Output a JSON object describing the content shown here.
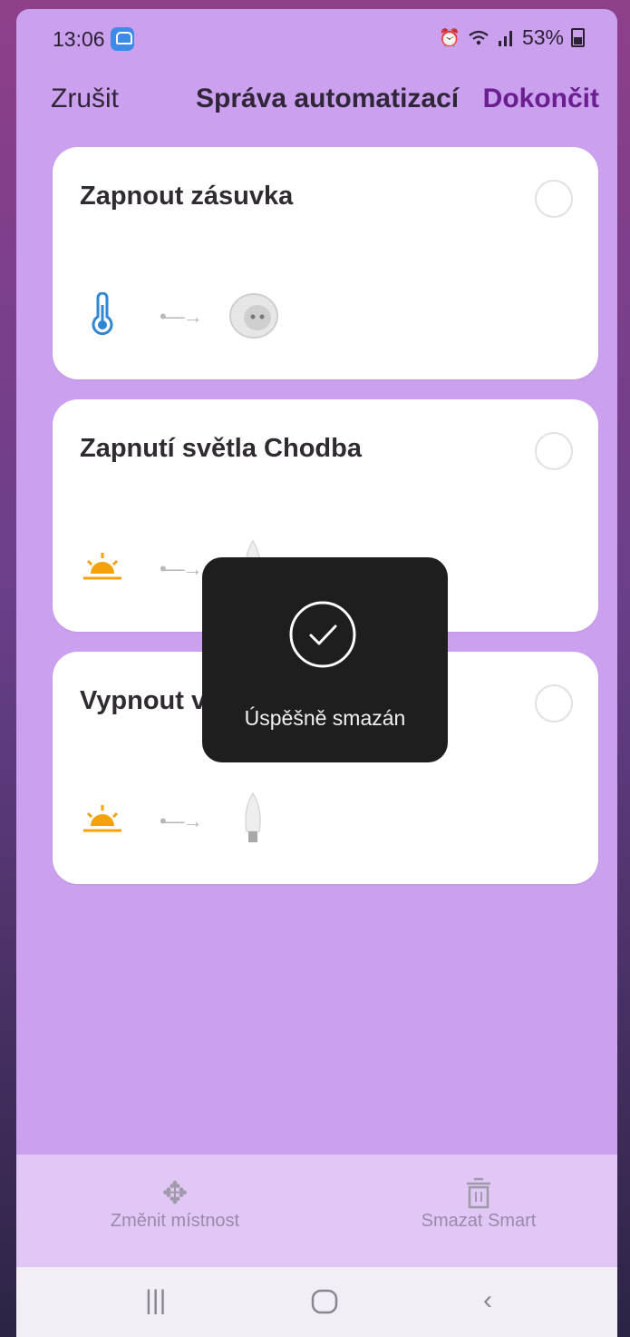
{
  "status_bar": {
    "time": "13:06",
    "battery": "53%",
    "icons": [
      "app-notification-icon",
      "alarm-icon",
      "wifi-icon",
      "signal-icon",
      "battery-icon"
    ]
  },
  "header": {
    "cancel_label": "Zrušit",
    "title": "Správa automatizací",
    "done_label": "Dokončit"
  },
  "automations": [
    {
      "name": "Zapnout zásuvka",
      "trigger_icon": "thermometer-icon",
      "device_icon": "smart-plug-icon"
    },
    {
      "name": "Zapnutí světla Chodba",
      "trigger_icon": "sunrise-icon",
      "device_icon": "bulb-icon"
    },
    {
      "name": "Vypnout východ",
      "trigger_icon": "sunrise-icon",
      "device_icon": "bulb-icon"
    }
  ],
  "toast": {
    "message": "Úspěšně smazán",
    "icon": "check-circle-icon"
  },
  "toolbar": {
    "move_label": "Změnit místnost",
    "delete_label": "Smazat Smart"
  },
  "colors": {
    "background": "#cba0ef",
    "accent": "#6a1e90",
    "thermometer": "#2f86d6",
    "sunrise": "#f3a20a"
  }
}
